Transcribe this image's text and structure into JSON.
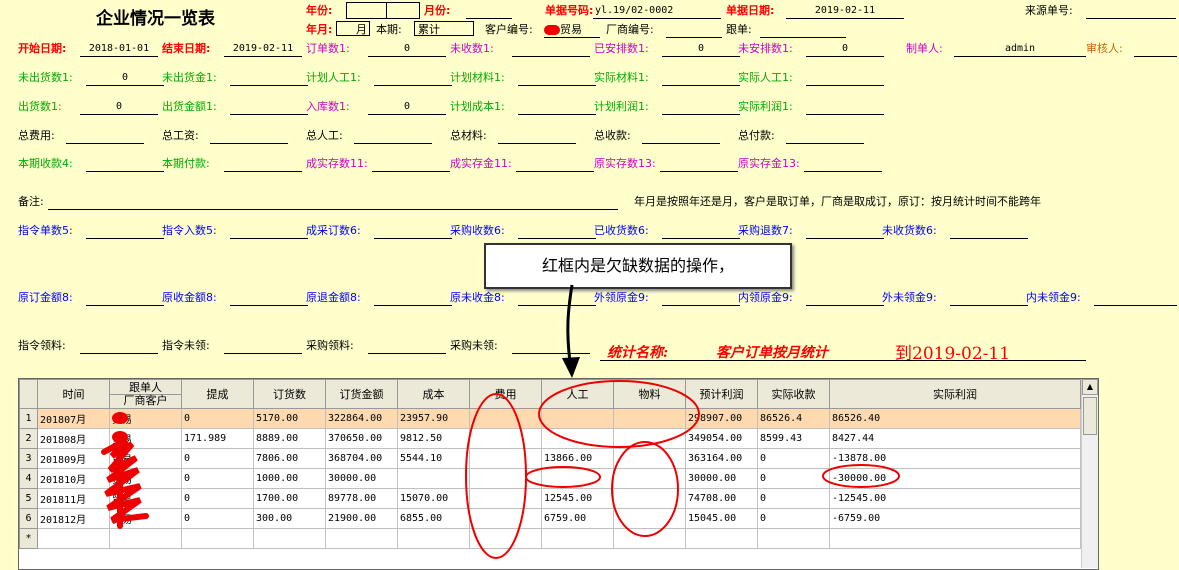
{
  "title": "企业情况一览表",
  "header": {
    "year_label": "年份:",
    "year_value": "",
    "month_label": "月份:",
    "month_value": "",
    "doc_no_label": "单据号码:",
    "doc_no_value": "yl.19/02-0002",
    "doc_date_label": "单据日期:",
    "doc_date_value": "2019-02-11",
    "source_no_label": "来源单号:",
    "source_no_value": "",
    "yearmonth_label": "年月:",
    "yearmonth_value": "月",
    "period_label": "本期:",
    "period_value": "累计",
    "customer_no_label": "客户编号:",
    "customer_no_value": "贸易",
    "vendor_no_label": "厂商编号:",
    "vendor_no_value": "",
    "follower_label": "跟单:",
    "follower_value": ""
  },
  "rows": [
    [
      {
        "label": "开始日期:",
        "value": "2018-01-01",
        "color": "red"
      },
      {
        "label": "结束日期:",
        "value": "2019-02-11",
        "color": "red"
      },
      {
        "label": "订单数1:",
        "value": "0",
        "color": "purple"
      },
      {
        "label": "未收数1:",
        "value": "",
        "color": "purple"
      },
      {
        "label": "已安排数1:",
        "value": "0",
        "color": "purple"
      },
      {
        "label": "未安排数1:",
        "value": "0",
        "color": "purple"
      },
      {
        "label": "制单人:",
        "value": "admin",
        "color": "purple"
      },
      {
        "label": "审核人:",
        "value": "",
        "color": "orange"
      }
    ],
    [
      {
        "label": "未出货数1:",
        "value": "0",
        "color": "green"
      },
      {
        "label": "未出货金1:",
        "value": "",
        "color": "green"
      },
      {
        "label": "计划人工1:",
        "value": "",
        "color": "green"
      },
      {
        "label": "计划材料1:",
        "value": "",
        "color": "green"
      },
      {
        "label": "实际材料1:",
        "value": "",
        "color": "green"
      },
      {
        "label": "实际人工1:",
        "value": "",
        "color": "green"
      }
    ],
    [
      {
        "label": "出货数1:",
        "value": "0",
        "color": "green"
      },
      {
        "label": "出货金额1:",
        "value": "",
        "color": "green"
      },
      {
        "label": "入库数1:",
        "value": "0",
        "color": "purple"
      },
      {
        "label": "计划成本1:",
        "value": "",
        "color": "green"
      },
      {
        "label": "计划利润1:",
        "value": "",
        "color": "green"
      },
      {
        "label": "实际利润1:",
        "value": "",
        "color": "green"
      }
    ],
    [
      {
        "label": "总费用:",
        "value": "",
        "color": "black"
      },
      {
        "label": "总工资:",
        "value": "",
        "color": "black"
      },
      {
        "label": "总人工:",
        "value": "",
        "color": "black"
      },
      {
        "label": "总材料:",
        "value": "",
        "color": "black"
      },
      {
        "label": "总收款:",
        "value": "",
        "color": "black"
      },
      {
        "label": "总付款:",
        "value": "",
        "color": "black"
      }
    ],
    [
      {
        "label": "本期收款4:",
        "value": "",
        "color": "green"
      },
      {
        "label": "本期付款:",
        "value": "",
        "color": "green"
      },
      {
        "label": "成实存数11:",
        "value": "",
        "color": "purple"
      },
      {
        "label": "成实存金11:",
        "value": "",
        "color": "purple"
      },
      {
        "label": "原实存数13:",
        "value": "",
        "color": "purple"
      },
      {
        "label": "原实存金13:",
        "value": "",
        "color": "purple"
      }
    ]
  ],
  "remark_label": "备注:",
  "remark_value": "",
  "remark_note": "年月是按照年还是月，客户是取订单，厂商是取成订，原订：按月统计时间不能跨年",
  "rows2": [
    [
      {
        "label": "指令单数5:",
        "value": "",
        "color": "blue"
      },
      {
        "label": "指令入数5:",
        "value": "",
        "color": "blue"
      },
      {
        "label": "成采订数6:",
        "value": "",
        "color": "blue"
      },
      {
        "label": "采购收数6:",
        "value": "",
        "color": "blue"
      },
      {
        "label": "已收货数6:",
        "value": "",
        "color": "blue"
      },
      {
        "label": "采购退数7:",
        "value": "",
        "color": "blue"
      },
      {
        "label": "未收货数6:",
        "value": "",
        "color": "blue"
      }
    ],
    [
      {
        "label": "原订金额8:",
        "value": "",
        "color": "blue"
      },
      {
        "label": "原收金额8:",
        "value": "",
        "color": "blue"
      },
      {
        "label": "原退金额8:",
        "value": "",
        "color": "blue"
      },
      {
        "label": "原未收金8:",
        "value": "",
        "color": "blue"
      },
      {
        "label": "外领原金9:",
        "value": "",
        "color": "blue"
      },
      {
        "label": "内领原金9:",
        "value": "",
        "color": "blue"
      },
      {
        "label": "外未领金9:",
        "value": "",
        "color": "blue"
      },
      {
        "label": "内未领金9:",
        "value": "",
        "color": "blue"
      }
    ],
    [
      {
        "label": "指令领料:",
        "value": "",
        "color": "black"
      },
      {
        "label": "指令未领:",
        "value": "",
        "color": "black"
      },
      {
        "label": "采购领料:",
        "value": "",
        "color": "black"
      },
      {
        "label": "采购未领:",
        "value": "",
        "color": "black"
      }
    ]
  ],
  "callout_text": "红框内是欠缺数据的操作，",
  "stat_label": "统计名称:",
  "stat_value": "客户订单按月统计",
  "stat_to": "到2019-02-11",
  "grid": {
    "columns": [
      "时间",
      "跟单人|厂商客户",
      "提成",
      "订货数",
      "订货金额",
      "成本",
      "费用",
      "人工",
      "物料",
      "预计利润",
      "实际收款",
      "实际利润"
    ],
    "rows": [
      [
        "1",
        "201807月",
        "贸易",
        "0",
        "5170.00",
        "322864.00",
        "23957.90",
        "",
        "",
        "",
        "298907.00",
        "86526.4",
        "86526.40"
      ],
      [
        "2",
        "201808月",
        "贸易",
        "171.989",
        "8889.00",
        "370650.00",
        "9812.50",
        "",
        "",
        "",
        "349054.00",
        "8599.43",
        "8427.44"
      ],
      [
        "3",
        "201809月",
        "贸易",
        "0",
        "7806.00",
        "368704.00",
        "5544.10",
        "",
        "13866.00",
        "",
        "363164.00",
        "0",
        "-13878.00"
      ],
      [
        "4",
        "201810月",
        "贸易",
        "0",
        "1000.00",
        "30000.00",
        "",
        "",
        "",
        "",
        "30000.00",
        "0",
        "-30000.00"
      ],
      [
        "5",
        "201811月",
        "贸易",
        "0",
        "1700.00",
        "89778.00",
        "15070.00",
        "",
        "12545.00",
        "",
        "74708.00",
        "0",
        "-12545.00"
      ],
      [
        "6",
        "201812月",
        "贸易",
        "0",
        "300.00",
        "21900.00",
        "6855.00",
        "",
        "6759.00",
        "",
        "15045.00",
        "0",
        "-6759.00"
      ],
      [
        "*",
        "",
        "",
        "",
        "",
        "",
        "",
        "",
        "",
        "",
        "",
        "",
        ""
      ]
    ]
  }
}
